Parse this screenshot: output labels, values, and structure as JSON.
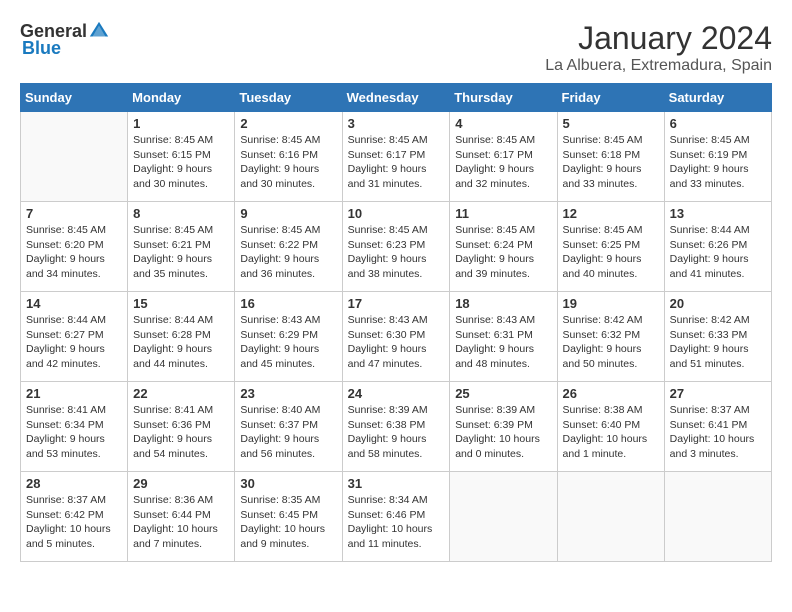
{
  "logo": {
    "general": "General",
    "blue": "Blue"
  },
  "header": {
    "title": "January 2024",
    "location": "La Albuera, Extremadura, Spain"
  },
  "weekdays": [
    "Sunday",
    "Monday",
    "Tuesday",
    "Wednesday",
    "Thursday",
    "Friday",
    "Saturday"
  ],
  "weeks": [
    [
      {
        "day": "",
        "info": ""
      },
      {
        "day": "1",
        "info": "Sunrise: 8:45 AM\nSunset: 6:15 PM\nDaylight: 9 hours\nand 30 minutes."
      },
      {
        "day": "2",
        "info": "Sunrise: 8:45 AM\nSunset: 6:16 PM\nDaylight: 9 hours\nand 30 minutes."
      },
      {
        "day": "3",
        "info": "Sunrise: 8:45 AM\nSunset: 6:17 PM\nDaylight: 9 hours\nand 31 minutes."
      },
      {
        "day": "4",
        "info": "Sunrise: 8:45 AM\nSunset: 6:17 PM\nDaylight: 9 hours\nand 32 minutes."
      },
      {
        "day": "5",
        "info": "Sunrise: 8:45 AM\nSunset: 6:18 PM\nDaylight: 9 hours\nand 33 minutes."
      },
      {
        "day": "6",
        "info": "Sunrise: 8:45 AM\nSunset: 6:19 PM\nDaylight: 9 hours\nand 33 minutes."
      }
    ],
    [
      {
        "day": "7",
        "info": "Sunrise: 8:45 AM\nSunset: 6:20 PM\nDaylight: 9 hours\nand 34 minutes."
      },
      {
        "day": "8",
        "info": "Sunrise: 8:45 AM\nSunset: 6:21 PM\nDaylight: 9 hours\nand 35 minutes."
      },
      {
        "day": "9",
        "info": "Sunrise: 8:45 AM\nSunset: 6:22 PM\nDaylight: 9 hours\nand 36 minutes."
      },
      {
        "day": "10",
        "info": "Sunrise: 8:45 AM\nSunset: 6:23 PM\nDaylight: 9 hours\nand 38 minutes."
      },
      {
        "day": "11",
        "info": "Sunrise: 8:45 AM\nSunset: 6:24 PM\nDaylight: 9 hours\nand 39 minutes."
      },
      {
        "day": "12",
        "info": "Sunrise: 8:45 AM\nSunset: 6:25 PM\nDaylight: 9 hours\nand 40 minutes."
      },
      {
        "day": "13",
        "info": "Sunrise: 8:44 AM\nSunset: 6:26 PM\nDaylight: 9 hours\nand 41 minutes."
      }
    ],
    [
      {
        "day": "14",
        "info": "Sunrise: 8:44 AM\nSunset: 6:27 PM\nDaylight: 9 hours\nand 42 minutes."
      },
      {
        "day": "15",
        "info": "Sunrise: 8:44 AM\nSunset: 6:28 PM\nDaylight: 9 hours\nand 44 minutes."
      },
      {
        "day": "16",
        "info": "Sunrise: 8:43 AM\nSunset: 6:29 PM\nDaylight: 9 hours\nand 45 minutes."
      },
      {
        "day": "17",
        "info": "Sunrise: 8:43 AM\nSunset: 6:30 PM\nDaylight: 9 hours\nand 47 minutes."
      },
      {
        "day": "18",
        "info": "Sunrise: 8:43 AM\nSunset: 6:31 PM\nDaylight: 9 hours\nand 48 minutes."
      },
      {
        "day": "19",
        "info": "Sunrise: 8:42 AM\nSunset: 6:32 PM\nDaylight: 9 hours\nand 50 minutes."
      },
      {
        "day": "20",
        "info": "Sunrise: 8:42 AM\nSunset: 6:33 PM\nDaylight: 9 hours\nand 51 minutes."
      }
    ],
    [
      {
        "day": "21",
        "info": "Sunrise: 8:41 AM\nSunset: 6:34 PM\nDaylight: 9 hours\nand 53 minutes."
      },
      {
        "day": "22",
        "info": "Sunrise: 8:41 AM\nSunset: 6:36 PM\nDaylight: 9 hours\nand 54 minutes."
      },
      {
        "day": "23",
        "info": "Sunrise: 8:40 AM\nSunset: 6:37 PM\nDaylight: 9 hours\nand 56 minutes."
      },
      {
        "day": "24",
        "info": "Sunrise: 8:39 AM\nSunset: 6:38 PM\nDaylight: 9 hours\nand 58 minutes."
      },
      {
        "day": "25",
        "info": "Sunrise: 8:39 AM\nSunset: 6:39 PM\nDaylight: 10 hours\nand 0 minutes."
      },
      {
        "day": "26",
        "info": "Sunrise: 8:38 AM\nSunset: 6:40 PM\nDaylight: 10 hours\nand 1 minute."
      },
      {
        "day": "27",
        "info": "Sunrise: 8:37 AM\nSunset: 6:41 PM\nDaylight: 10 hours\nand 3 minutes."
      }
    ],
    [
      {
        "day": "28",
        "info": "Sunrise: 8:37 AM\nSunset: 6:42 PM\nDaylight: 10 hours\nand 5 minutes."
      },
      {
        "day": "29",
        "info": "Sunrise: 8:36 AM\nSunset: 6:44 PM\nDaylight: 10 hours\nand 7 minutes."
      },
      {
        "day": "30",
        "info": "Sunrise: 8:35 AM\nSunset: 6:45 PM\nDaylight: 10 hours\nand 9 minutes."
      },
      {
        "day": "31",
        "info": "Sunrise: 8:34 AM\nSunset: 6:46 PM\nDaylight: 10 hours\nand 11 minutes."
      },
      {
        "day": "",
        "info": ""
      },
      {
        "day": "",
        "info": ""
      },
      {
        "day": "",
        "info": ""
      }
    ]
  ]
}
